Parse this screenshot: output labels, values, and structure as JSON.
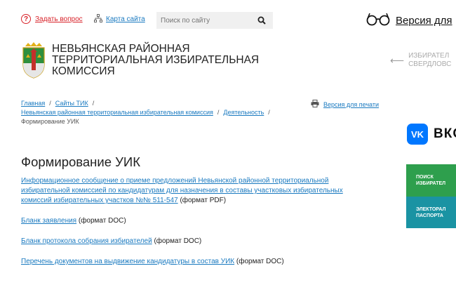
{
  "topbar": {
    "ask_question": "Задать вопрос",
    "sitemap": "Карта сайта",
    "search_placeholder": "Поиск по сайту",
    "vision_version": "Версия для"
  },
  "header": {
    "title": "Невьянская районная территориальная избирательная комиссия",
    "prev_link_line1": "ИЗБИРАТЕЛ",
    "prev_link_line2": "СВЕРДЛОВС"
  },
  "breadcrumbs": {
    "home": "Главная",
    "tik_sites": "Сайты ТИК",
    "commission": "Невьянская районная территориальная избирательная комиссия",
    "activity": "Деятельность",
    "current": "Формирование УИК",
    "sep": "/"
  },
  "print_version": "Версия для печати",
  "page_title": "Формирование УИК",
  "documents": [
    {
      "link": "Информационное сообщение о приеме предложений Невьянской районной территориальной избирательной комиссией по кандидатурам для назначения в составы участковых избирательных комиссий избирательных участков №№ 511-547",
      "format": "(формат PDF)"
    },
    {
      "link": "Бланк заявления",
      "format": "(формат DOC)"
    },
    {
      "link": "Бланк протокола собрания избирателей",
      "format": "(формат DOC)"
    },
    {
      "link": "Перечень документов на выдвижение кандидатуры в состав УИК",
      "format": "(формат DOC)"
    }
  ],
  "sidebar": {
    "vk_logo": "VK",
    "vk_text": "ВКО",
    "banner1_line1": "ПОИСК",
    "banner1_line2": "ИЗБИРАТЕЛ",
    "banner2_line1": "ЭЛЕКТОРАЛ",
    "banner2_line2": "ПАСПОРТА"
  },
  "colors": {
    "link": "#1a7ac0",
    "accent_red": "#d8232a",
    "banner_green": "#2e9f4d",
    "banner_teal": "#1a93a3",
    "vk_blue": "#0077ff"
  }
}
